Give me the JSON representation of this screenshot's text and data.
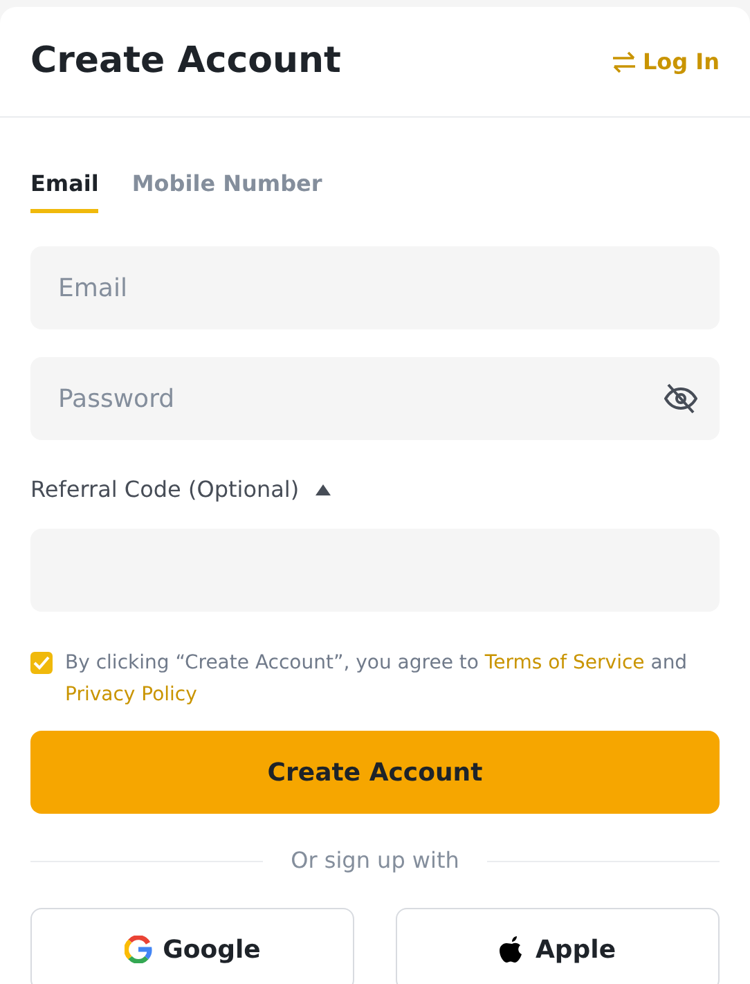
{
  "header": {
    "title": "Create Account",
    "login_link": "Log In"
  },
  "tabs": [
    {
      "label": "Email",
      "selected": true
    },
    {
      "label": "Mobile Number",
      "selected": false
    }
  ],
  "email_field": {
    "placeholder": "Email"
  },
  "password_field": {
    "placeholder": "Password",
    "visible": false
  },
  "referral": {
    "label": "Referral Code (Optional)",
    "expanded": true
  },
  "agreement": {
    "checked": true,
    "parts": [
      {
        "kind": "text",
        "text": "By clicking “Create Account”, you agree to"
      },
      {
        "kind": "link",
        "text": "Terms of Service"
      },
      {
        "kind": "text",
        "text": "and"
      },
      {
        "kind": "link",
        "text": "Privacy Policy"
      }
    ]
  },
  "submit_button": "Create Account",
  "divider_text": "Or sign up with",
  "social_buttons": [
    {
      "kind": "google",
      "label": "Google"
    },
    {
      "kind": "apple",
      "label": "Apple"
    }
  ]
}
